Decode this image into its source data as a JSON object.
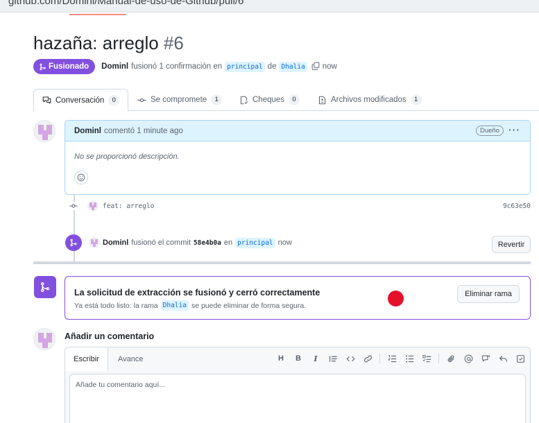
{
  "browser": {
    "url": "github.com/Domini/Manual-de-uso-de-Github/pull/6"
  },
  "pr": {
    "title": "hazaña: arreglo",
    "number": "#6",
    "state_badge": "Fusionado",
    "author": "Dominl",
    "action_text": "fusionó 1 confirmación en",
    "base_branch": "principal",
    "from_word": "de",
    "head_branch": "Dhalia",
    "time": "now"
  },
  "tabs": [
    {
      "label": "Conversación",
      "count": "0"
    },
    {
      "label": "Se compromete",
      "count": "1"
    },
    {
      "label": "Cheques",
      "count": "0"
    },
    {
      "label": "Archivos modificados",
      "count": "1"
    }
  ],
  "comment": {
    "author": "Dominl",
    "action": "comentó 1 minute ago",
    "role_badge": "Dueño",
    "menu": "···",
    "body": "No se proporcionó descripción."
  },
  "commit": {
    "message": "feat: arreglo",
    "sha": "9c63e50"
  },
  "merge_event": {
    "author": "Dominl",
    "text": "fusionó el commit",
    "sha": "58e4b0a",
    "in_word": "en",
    "branch": "principal",
    "time": "now",
    "revert_label": "Revertir"
  },
  "merge_status": {
    "heading": "La solicitud de extracción se fusionó y cerró correctamente",
    "sub_before": "Ya está todo listo: la rama",
    "branch": "Dhalia",
    "sub_after": "se puede eliminar de forma segura.",
    "delete_label": "Eliminar rama"
  },
  "add_comment": {
    "heading": "Añadir un comentario",
    "tab_write": "Escribir",
    "tab_preview": "Avance",
    "placeholder": "Añade tu comentario aquí...",
    "toolbar_heading": "H",
    "toolbar_bold": "B",
    "toolbar_italic": "I"
  },
  "colors": {
    "merged": "#8250df",
    "link": "#0969da",
    "chip_bg": "#ddf4ff",
    "red_dot": "#e3122a"
  }
}
